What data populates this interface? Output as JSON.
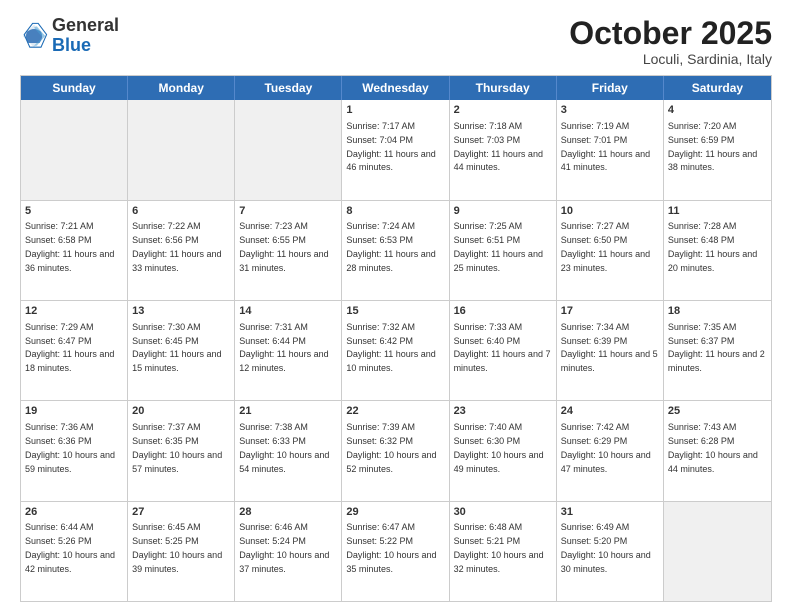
{
  "header": {
    "logo_general": "General",
    "logo_blue": "Blue",
    "month_title": "October 2025",
    "location": "Loculi, Sardinia, Italy"
  },
  "weekdays": [
    "Sunday",
    "Monday",
    "Tuesday",
    "Wednesday",
    "Thursday",
    "Friday",
    "Saturday"
  ],
  "rows": [
    [
      {
        "day": "",
        "info": "",
        "shaded": true
      },
      {
        "day": "",
        "info": "",
        "shaded": true
      },
      {
        "day": "",
        "info": "",
        "shaded": true
      },
      {
        "day": "1",
        "info": "Sunrise: 7:17 AM\nSunset: 7:04 PM\nDaylight: 11 hours and 46 minutes."
      },
      {
        "day": "2",
        "info": "Sunrise: 7:18 AM\nSunset: 7:03 PM\nDaylight: 11 hours and 44 minutes."
      },
      {
        "day": "3",
        "info": "Sunrise: 7:19 AM\nSunset: 7:01 PM\nDaylight: 11 hours and 41 minutes."
      },
      {
        "day": "4",
        "info": "Sunrise: 7:20 AM\nSunset: 6:59 PM\nDaylight: 11 hours and 38 minutes."
      }
    ],
    [
      {
        "day": "5",
        "info": "Sunrise: 7:21 AM\nSunset: 6:58 PM\nDaylight: 11 hours and 36 minutes."
      },
      {
        "day": "6",
        "info": "Sunrise: 7:22 AM\nSunset: 6:56 PM\nDaylight: 11 hours and 33 minutes."
      },
      {
        "day": "7",
        "info": "Sunrise: 7:23 AM\nSunset: 6:55 PM\nDaylight: 11 hours and 31 minutes."
      },
      {
        "day": "8",
        "info": "Sunrise: 7:24 AM\nSunset: 6:53 PM\nDaylight: 11 hours and 28 minutes."
      },
      {
        "day": "9",
        "info": "Sunrise: 7:25 AM\nSunset: 6:51 PM\nDaylight: 11 hours and 25 minutes."
      },
      {
        "day": "10",
        "info": "Sunrise: 7:27 AM\nSunset: 6:50 PM\nDaylight: 11 hours and 23 minutes."
      },
      {
        "day": "11",
        "info": "Sunrise: 7:28 AM\nSunset: 6:48 PM\nDaylight: 11 hours and 20 minutes."
      }
    ],
    [
      {
        "day": "12",
        "info": "Sunrise: 7:29 AM\nSunset: 6:47 PM\nDaylight: 11 hours and 18 minutes."
      },
      {
        "day": "13",
        "info": "Sunrise: 7:30 AM\nSunset: 6:45 PM\nDaylight: 11 hours and 15 minutes."
      },
      {
        "day": "14",
        "info": "Sunrise: 7:31 AM\nSunset: 6:44 PM\nDaylight: 11 hours and 12 minutes."
      },
      {
        "day": "15",
        "info": "Sunrise: 7:32 AM\nSunset: 6:42 PM\nDaylight: 11 hours and 10 minutes."
      },
      {
        "day": "16",
        "info": "Sunrise: 7:33 AM\nSunset: 6:40 PM\nDaylight: 11 hours and 7 minutes."
      },
      {
        "day": "17",
        "info": "Sunrise: 7:34 AM\nSunset: 6:39 PM\nDaylight: 11 hours and 5 minutes."
      },
      {
        "day": "18",
        "info": "Sunrise: 7:35 AM\nSunset: 6:37 PM\nDaylight: 11 hours and 2 minutes."
      }
    ],
    [
      {
        "day": "19",
        "info": "Sunrise: 7:36 AM\nSunset: 6:36 PM\nDaylight: 10 hours and 59 minutes."
      },
      {
        "day": "20",
        "info": "Sunrise: 7:37 AM\nSunset: 6:35 PM\nDaylight: 10 hours and 57 minutes."
      },
      {
        "day": "21",
        "info": "Sunrise: 7:38 AM\nSunset: 6:33 PM\nDaylight: 10 hours and 54 minutes."
      },
      {
        "day": "22",
        "info": "Sunrise: 7:39 AM\nSunset: 6:32 PM\nDaylight: 10 hours and 52 minutes."
      },
      {
        "day": "23",
        "info": "Sunrise: 7:40 AM\nSunset: 6:30 PM\nDaylight: 10 hours and 49 minutes."
      },
      {
        "day": "24",
        "info": "Sunrise: 7:42 AM\nSunset: 6:29 PM\nDaylight: 10 hours and 47 minutes."
      },
      {
        "day": "25",
        "info": "Sunrise: 7:43 AM\nSunset: 6:28 PM\nDaylight: 10 hours and 44 minutes."
      }
    ],
    [
      {
        "day": "26",
        "info": "Sunrise: 6:44 AM\nSunset: 5:26 PM\nDaylight: 10 hours and 42 minutes."
      },
      {
        "day": "27",
        "info": "Sunrise: 6:45 AM\nSunset: 5:25 PM\nDaylight: 10 hours and 39 minutes."
      },
      {
        "day": "28",
        "info": "Sunrise: 6:46 AM\nSunset: 5:24 PM\nDaylight: 10 hours and 37 minutes."
      },
      {
        "day": "29",
        "info": "Sunrise: 6:47 AM\nSunset: 5:22 PM\nDaylight: 10 hours and 35 minutes."
      },
      {
        "day": "30",
        "info": "Sunrise: 6:48 AM\nSunset: 5:21 PM\nDaylight: 10 hours and 32 minutes."
      },
      {
        "day": "31",
        "info": "Sunrise: 6:49 AM\nSunset: 5:20 PM\nDaylight: 10 hours and 30 minutes."
      },
      {
        "day": "",
        "info": "",
        "shaded": true
      }
    ]
  ]
}
